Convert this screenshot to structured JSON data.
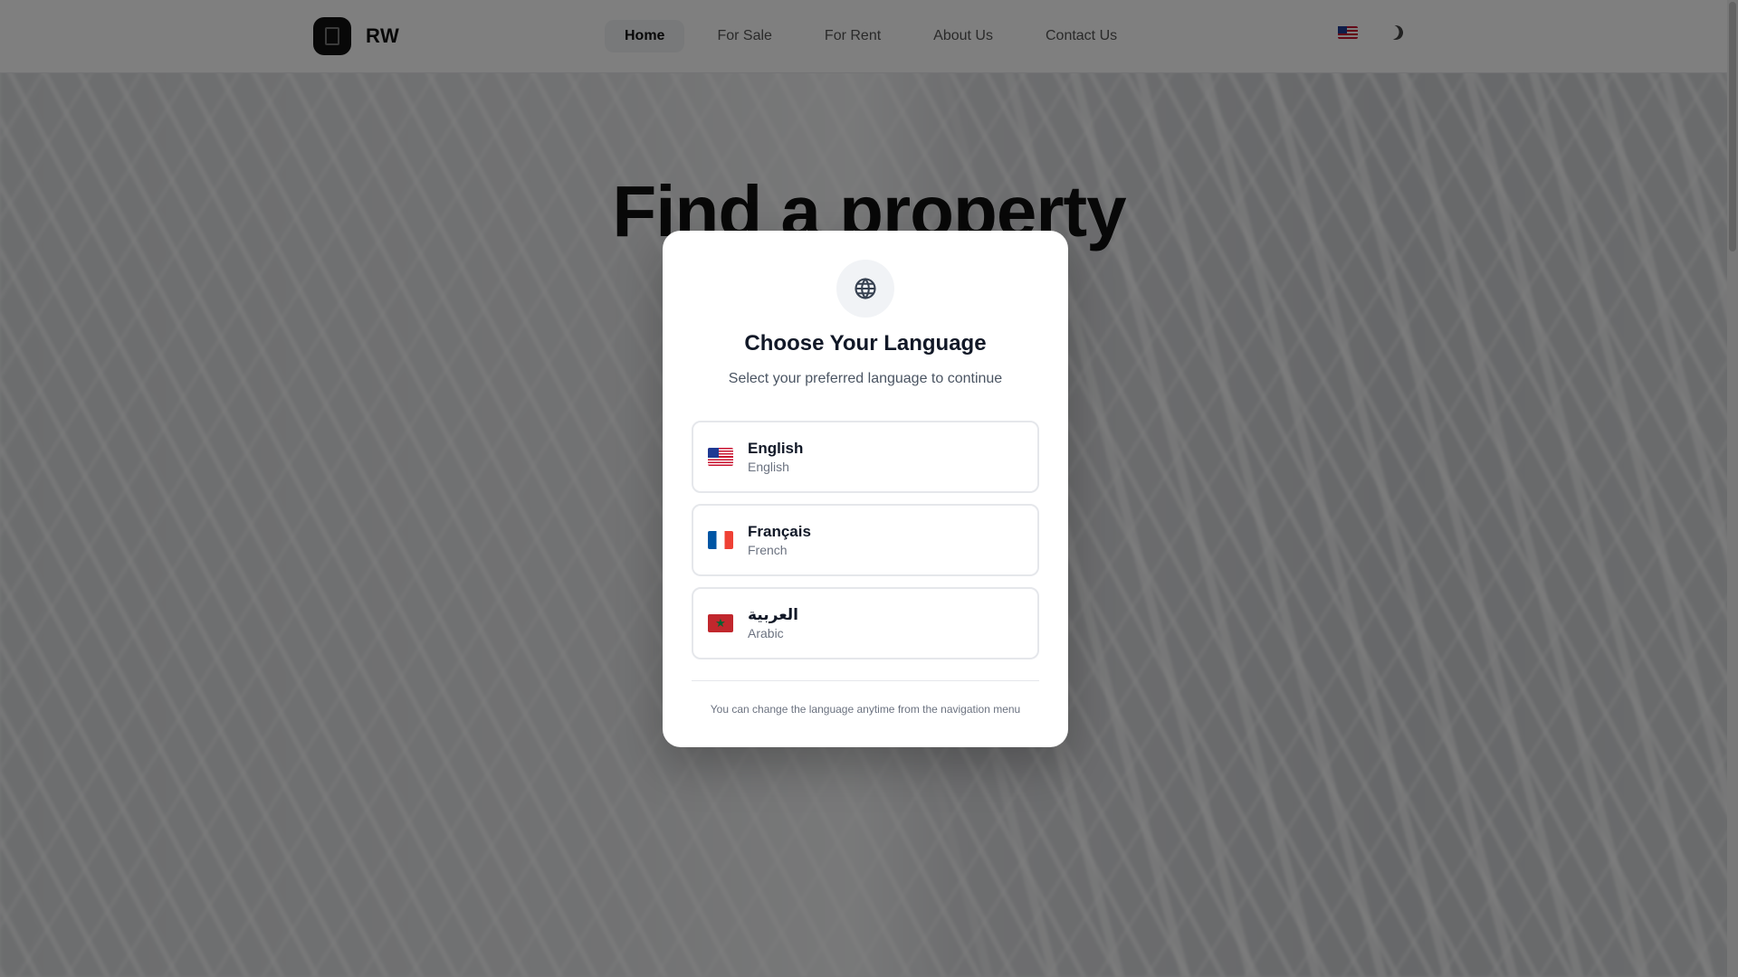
{
  "navbar": {
    "brand_name": "RW",
    "links": [
      {
        "label": "Home"
      },
      {
        "label": "For Sale"
      },
      {
        "label": "For Rent"
      },
      {
        "label": "About Us"
      },
      {
        "label": "Contact Us"
      }
    ],
    "active_link": "Home"
  },
  "hero": {
    "title_line1": "Find a property",
    "title_line2": "",
    "subtitle": ""
  },
  "modal": {
    "icon": "globe-icon",
    "title": "Choose Your Language",
    "subtitle": "Select your preferred language to continue",
    "languages": [
      {
        "native": "English",
        "english": "English",
        "flag": "us"
      },
      {
        "native": "Français",
        "english": "French",
        "flag": "fr"
      },
      {
        "native": "العربية",
        "english": "Arabic",
        "flag": "ma"
      }
    ],
    "footer": "You can change the language anytime from the navigation menu"
  },
  "colors": {
    "overlay": "rgba(0,0,0,0.5)",
    "modal_bg": "#ffffff",
    "title": "#111827",
    "muted": "#6b7280",
    "border": "#e5e7eb"
  }
}
